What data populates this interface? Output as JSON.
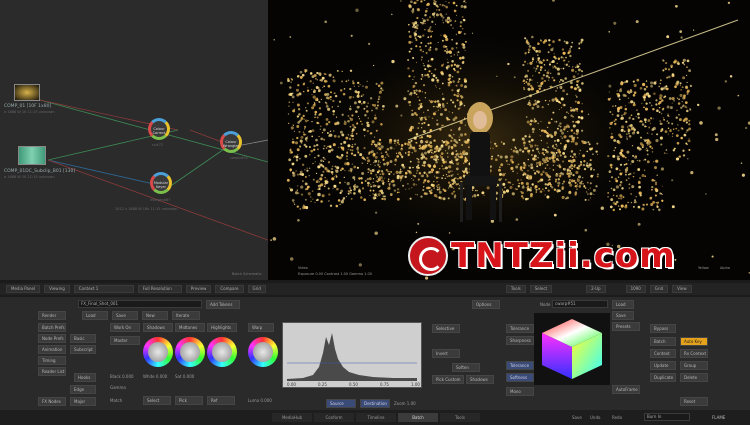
{
  "schematic": {
    "clip1": {
      "name": "COMP_01 [10F 1x80]",
      "sub": "a 1888 W 1K 11:15 unknown"
    },
    "clip2": {
      "name": "COMP_01DC_Subclip_B01 [130]",
      "sub": "a 1888 W 1K 11:15 unknown"
    },
    "cc1": "Colour Correct",
    "cc1_sub": "cc#72",
    "cc2": "Colour Wrangler",
    "cc2_sub": "cwarp#51",
    "cc3": "Modular Keyer",
    "cc3_sub": "mkeyer#87",
    "out_sub": "1012 x 1888 W 18k 11:15 unknown",
    "corner": "Batch Schematic",
    "corner_btn": "Rotate"
  },
  "viewer": {
    "readout1": "Video",
    "readout2": "Exposure 0.00   Contrast 1.00   Gamma 1.00",
    "readout3": "Yellow",
    "readout4": "Alpha"
  },
  "watermark": {
    "text": "TNTZii.com"
  },
  "toolbar": {
    "items": [
      "Media Panel",
      "Viewing",
      "Context 1",
      "Full Resolution",
      "Preview",
      "Compare",
      "Grid",
      "Tools",
      "Select",
      "2-Up",
      "Grid",
      "View"
    ],
    "frame": "1090"
  },
  "panel": {
    "render": "Render",
    "load": "Load",
    "save": "Save",
    "new": "New",
    "iterate": "Iterate",
    "batch_prefs": "Batch Prefs",
    "node_prefs": "Node Prefs",
    "node_prefs_val": "Basic",
    "animation": "Animation",
    "subscript": "Subscript",
    "timing": "Timing",
    "reader_list": "Reader List",
    "hooks": "Hooks",
    "fx_nodes": "FX Nodes",
    "edge": "Edge",
    "major": "Major",
    "clip_name": "FX_Final_Shot_001",
    "add_tokens": "Add Tokens",
    "work_on": "Work On",
    "master": "Master",
    "shadows": "Shadows",
    "midtones": "Midtones",
    "highlights": "Highlights",
    "black": "Black 0.000",
    "white": "White 0.000",
    "sat": "Sat 0.000",
    "gamma": "Gamma",
    "match": "Match",
    "select": "Select",
    "pick": "Pick",
    "ref": "Ref",
    "warp": "Warp",
    "luma": "Luma 0.000",
    "source": "Source",
    "destination": "Destination",
    "zoom": "Zoom 1.00",
    "options": "Options",
    "selective": "Selective",
    "invert": "Invert",
    "soften": "Soften",
    "pick_custom": "Pick Custom",
    "shadows2": "Shadows",
    "tolerance": "Tolerance",
    "sharpness": "Sharpness",
    "softness": "Softness",
    "mono": "Mono",
    "node": "Node",
    "node_val": "cwarp#51",
    "load2": "Load",
    "save2": "Save",
    "presets": "Presets",
    "autoframe": "AutoFrame",
    "bypass": "Bypass",
    "batch": "Batch",
    "auto_key": "Auto Key",
    "context": "Context",
    "rx_context": "Rx Context",
    "update": "Update",
    "group": "Group",
    "duplicate": "Duplicate",
    "delete": "Delete",
    "reset": "Reset",
    "hist_ticks": [
      "0.00",
      "0.25",
      "0.50",
      "0.75",
      "1.00"
    ]
  },
  "tabs": [
    "MediaHub",
    "Conform",
    "Timeline",
    "Batch",
    "Tools"
  ],
  "active_tab": "Batch",
  "status": {
    "save": "Save",
    "undo": "Undo",
    "redo": "Redo",
    "user": "Burn In",
    "flame": "FLAME"
  }
}
